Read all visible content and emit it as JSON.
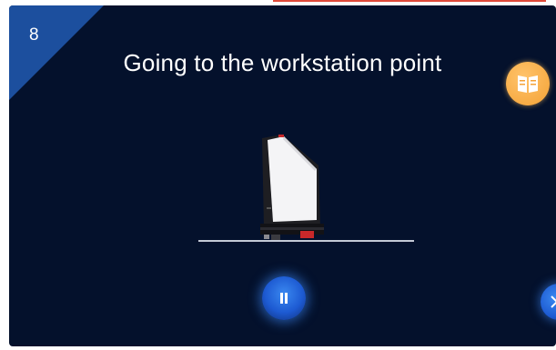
{
  "step": {
    "number": "8"
  },
  "status": {
    "title": "Going to the workstation point"
  },
  "icons": {
    "manual": "book-icon",
    "pause": "pause-icon",
    "next": "next-icon",
    "robot": "robot-icon"
  },
  "colors": {
    "background": "#04112c",
    "corner_badge": "#1c4f9e",
    "manual_button": "#f4a236",
    "control_button": "#1d5ad2",
    "floor_line": "#c4cad6"
  }
}
